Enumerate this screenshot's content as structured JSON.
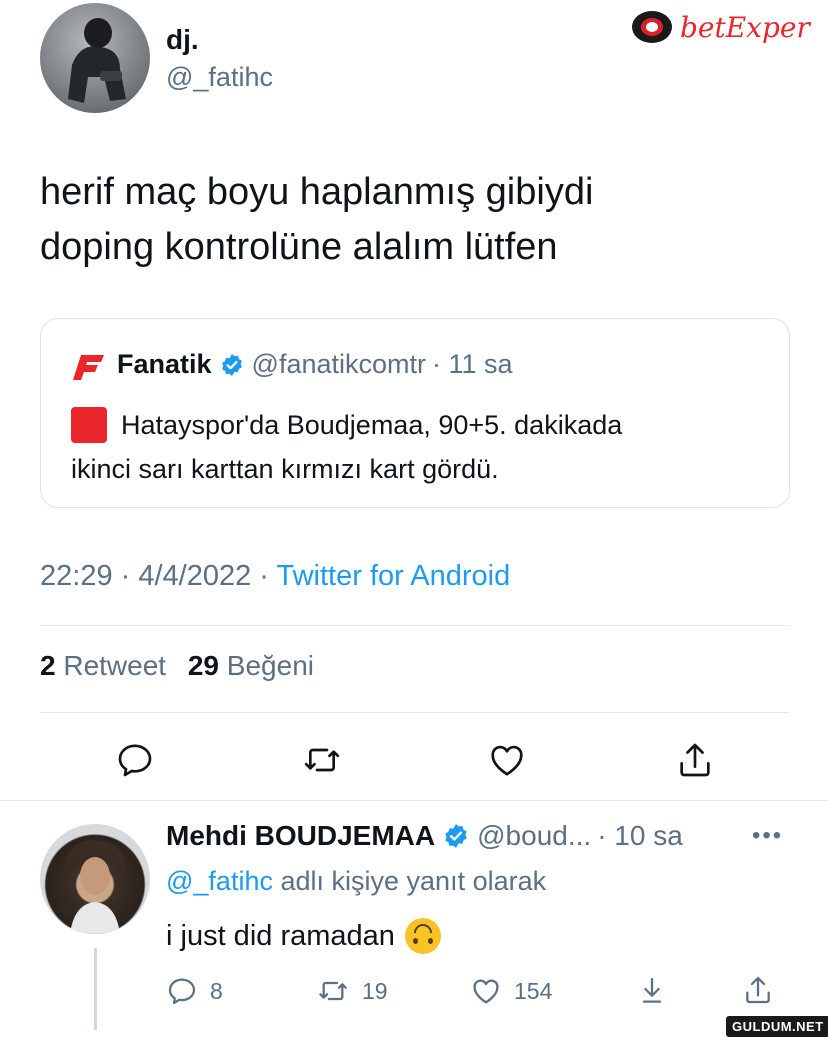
{
  "watermark": {
    "brand": "betExper",
    "site": "GULDUM.NET"
  },
  "tweet": {
    "author_name": "dj.",
    "author_handle": "@_fatihc",
    "text_line1": "herif maç boyu haplanmış gibiydi",
    "text_line2": "doping kontrolüne alalım lütfen",
    "quote": {
      "author_name": "Fanatik",
      "author_handle": "@fanatikcomtr",
      "time": "· 11 sa",
      "text_line1": "Hatayspor'da Boudjemaa, 90+5. dakikada",
      "text_line2": "ikinci sarı karttan kırmızı kart gördü."
    },
    "timestamp": "22:29 · 4/4/2022 ·",
    "source": "Twitter for Android",
    "stats": {
      "retweet_count": "2",
      "retweet_label": "Retweet",
      "like_count": "29",
      "like_label": "Beğeni"
    }
  },
  "reply": {
    "author_name": "Mehdi BOUDJEMAA",
    "author_handle": "@boud...",
    "time": "· 10 sa",
    "reply_to_handle": "@_fatihc",
    "reply_to_suffix": "adlı kişiye yanıt olarak",
    "text": "i just did ramadan",
    "emoji": "🙃",
    "counts": {
      "replies": "8",
      "retweets": "19",
      "likes": "154"
    }
  },
  "colors": {
    "accent": "#1d9bf0",
    "muted": "#5b7083",
    "brand_red": "#e8262b"
  }
}
